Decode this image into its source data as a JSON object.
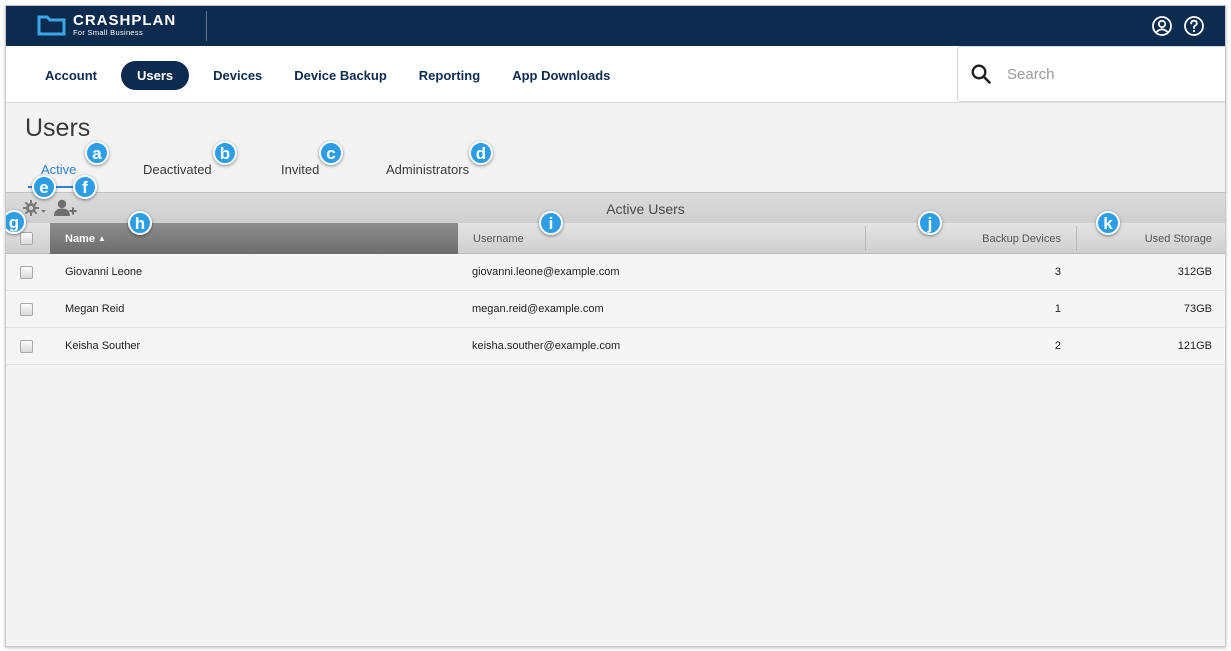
{
  "app": {
    "brand_name": "CRASHPLAN",
    "brand_sub": "For Small Business",
    "account_icon": "user-circle-icon",
    "help_icon": "help-circle-icon"
  },
  "nav": {
    "items": [
      {
        "label": "Account",
        "active": false
      },
      {
        "label": "Users",
        "active": true
      },
      {
        "label": "Devices",
        "active": false
      },
      {
        "label": "Device Backup",
        "active": false
      },
      {
        "label": "Reporting",
        "active": false
      },
      {
        "label": "App Downloads",
        "active": false
      }
    ]
  },
  "search": {
    "placeholder": "Search",
    "value": ""
  },
  "page": {
    "title": "Users",
    "tabs": [
      {
        "label": "Active",
        "active": true
      },
      {
        "label": "Deactivated",
        "active": false
      },
      {
        "label": "Invited",
        "active": false
      },
      {
        "label": "Administrators",
        "active": false
      }
    ],
    "band_title": "Active Users"
  },
  "table": {
    "columns": [
      {
        "label": "Name",
        "sort": "ascending",
        "sort_glyph": "▲"
      },
      {
        "label": "Username"
      },
      {
        "label": "Backup Devices"
      },
      {
        "label": "Used Storage"
      }
    ],
    "rows": [
      {
        "name": "Giovanni Leone",
        "username": "giovanni.leone@example.com",
        "devices": "3",
        "storage": "312GB"
      },
      {
        "name": "Megan Reid",
        "username": "megan.reid@example.com",
        "devices": "1",
        "storage": "73GB"
      },
      {
        "name": "Keisha Souther",
        "username": "keisha.souther@example.com",
        "devices": "2",
        "storage": "121GB"
      }
    ]
  },
  "callouts": [
    "a",
    "b",
    "c",
    "d",
    "e",
    "f",
    "g",
    "h",
    "i",
    "j",
    "k"
  ],
  "colors": {
    "brand_navy": "#0d2a4f",
    "active_tab_blue": "#2f7fd4",
    "callout_blue": "#2d9ee6"
  }
}
